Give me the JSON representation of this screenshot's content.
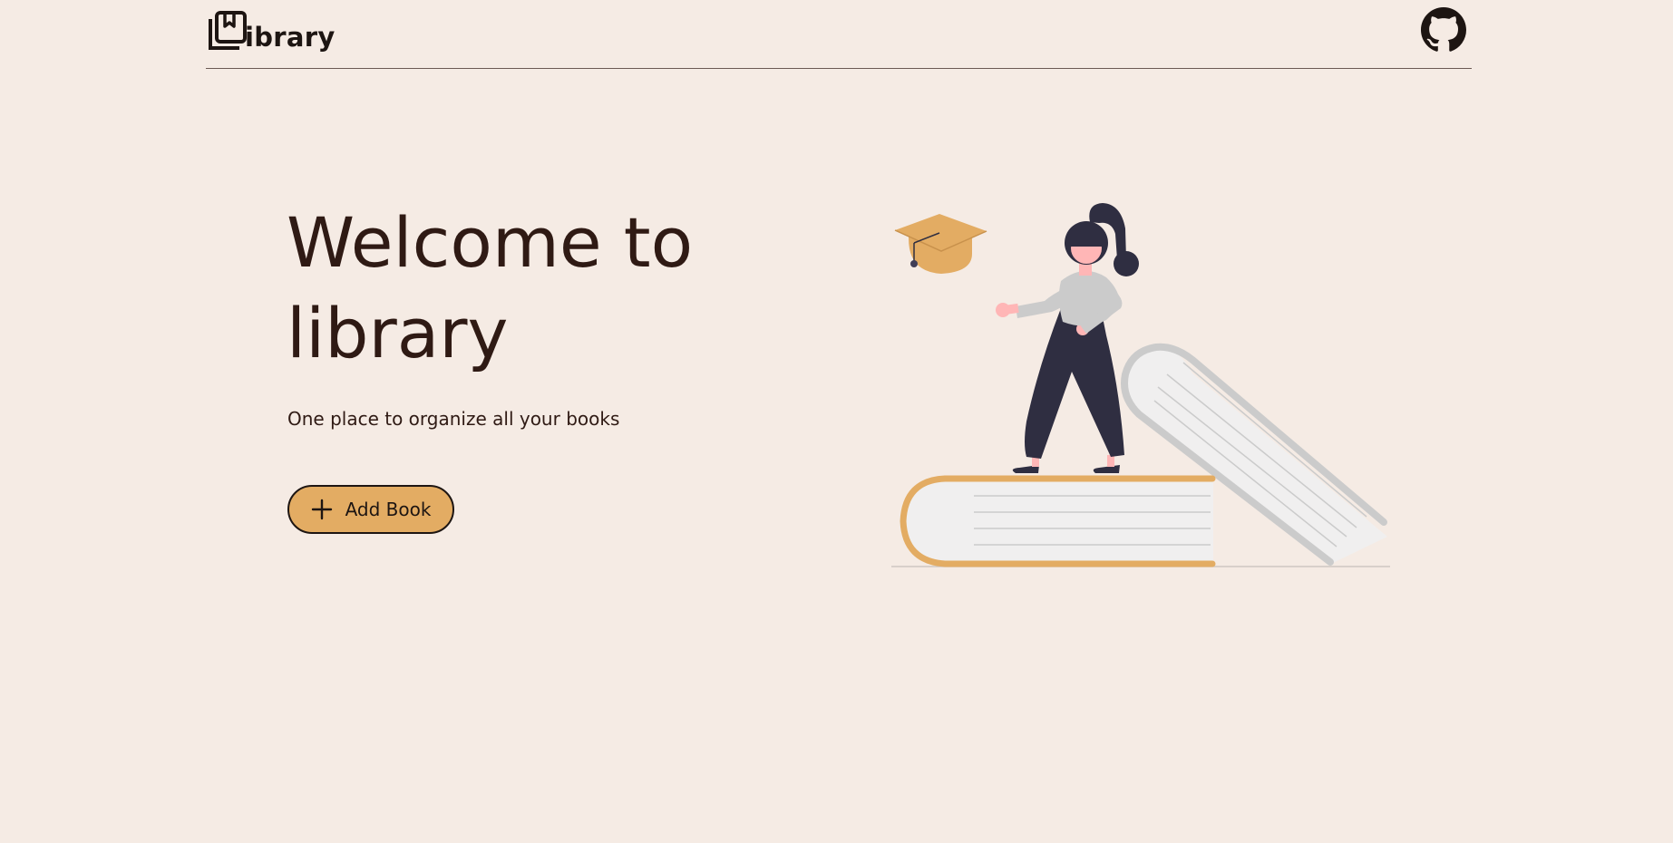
{
  "header": {
    "logo_text": "ibrary",
    "logo_icon": "book-stack-icon",
    "github_icon": "github-icon"
  },
  "hero": {
    "title": "Welcome to library",
    "subtitle": "One place to organize all your books",
    "add_button_label": "Add Book",
    "add_button_icon": "plus-icon"
  },
  "colors": {
    "background": "#f5ebe4",
    "text": "#2f1a14",
    "accent": "#e3ac63",
    "dark": "#1d1512"
  }
}
